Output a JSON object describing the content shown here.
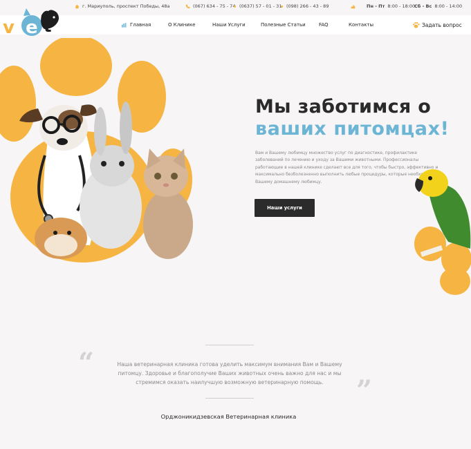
{
  "logo": {
    "text": "vet"
  },
  "topbar": {
    "address": "г. Мариуполь, проспект Победы, 48а",
    "phones": [
      "(067) 634 - 75 - 74",
      "(0637) 57 - 01 - 31",
      "(098) 266 - 43 - 89"
    ],
    "hours_weekdays_label": "Пн - Пт",
    "hours_weekdays": "8:00 - 18:00",
    "hours_weekend_label": "Сб - Вс",
    "hours_weekend": "8:00 - 14:00"
  },
  "nav": {
    "items": [
      "Главная",
      "О Клинике",
      "Наши Услуги",
      "Полезные Статьи",
      "FAQ",
      "Контакты"
    ],
    "ask": "Задать вопрос"
  },
  "hero": {
    "title_line1": "Мы заботимся о",
    "title_line2": "ваших питомцах!",
    "description": "Вам и Вашему любимцу множество услуг по диагностике, профилактике заболеваний по лечению и уходу за Вашими животными. Профессионалы работающие в нашей клинике сделают все для того, чтобы быстро, эффективно и максимально безболезненно выполнить любые процедуры, которые необходимы Вашему домашнему любимцу.",
    "button": "Наши услуги"
  },
  "quote": {
    "text": "Наша ветеринарная клиника готова уделить максимум внимания Вам и Вашему питомцу. Здоровье и благополучие Ваших животных очень важно для нас и мы стремимся оказать наилучшую возможную ветеринарную помощь.",
    "open_mark": "“",
    "close_mark": "”",
    "author": "Орджоникидзевская Ветеринарная клиника"
  },
  "colors": {
    "accent_orange": "#f6b443",
    "accent_blue": "#6cb5d5",
    "dark": "#2b2b2b"
  }
}
